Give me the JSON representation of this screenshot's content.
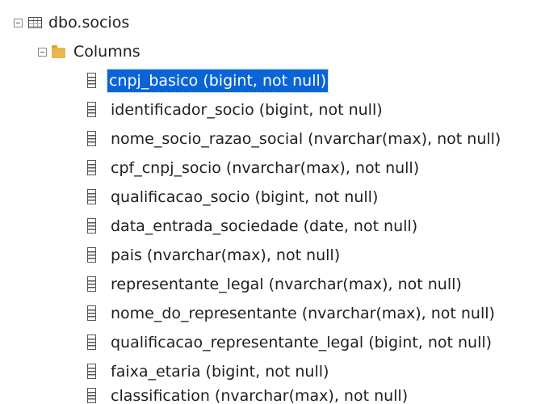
{
  "tree": {
    "table": {
      "name": "dbo.socios",
      "icon": "table-icon",
      "expanded": true
    },
    "columns_folder": {
      "label": "Columns",
      "icon": "folder-icon",
      "expanded": true
    },
    "columns": [
      {
        "label": "cnpj_basico (bigint, not null)",
        "selected": true
      },
      {
        "label": "identificador_socio (bigint, not null)"
      },
      {
        "label": "nome_socio_razao_social (nvarchar(max), not null)"
      },
      {
        "label": "cpf_cnpj_socio (nvarchar(max), not null)"
      },
      {
        "label": "qualificacao_socio (bigint, not null)"
      },
      {
        "label": "data_entrada_sociedade (date, not null)"
      },
      {
        "label": "pais (nvarchar(max), not null)"
      },
      {
        "label": "representante_legal (nvarchar(max), not null)"
      },
      {
        "label": "nome_do_representante (nvarchar(max), not null)"
      },
      {
        "label": "qualificacao_representante_legal (bigint, not null)"
      },
      {
        "label": "faixa_etaria (bigint, not null)"
      },
      {
        "label": "classification (nvarchar(max), not null)"
      }
    ],
    "colors": {
      "selection": "#0a64d8",
      "text": "#1e1e1e"
    }
  }
}
